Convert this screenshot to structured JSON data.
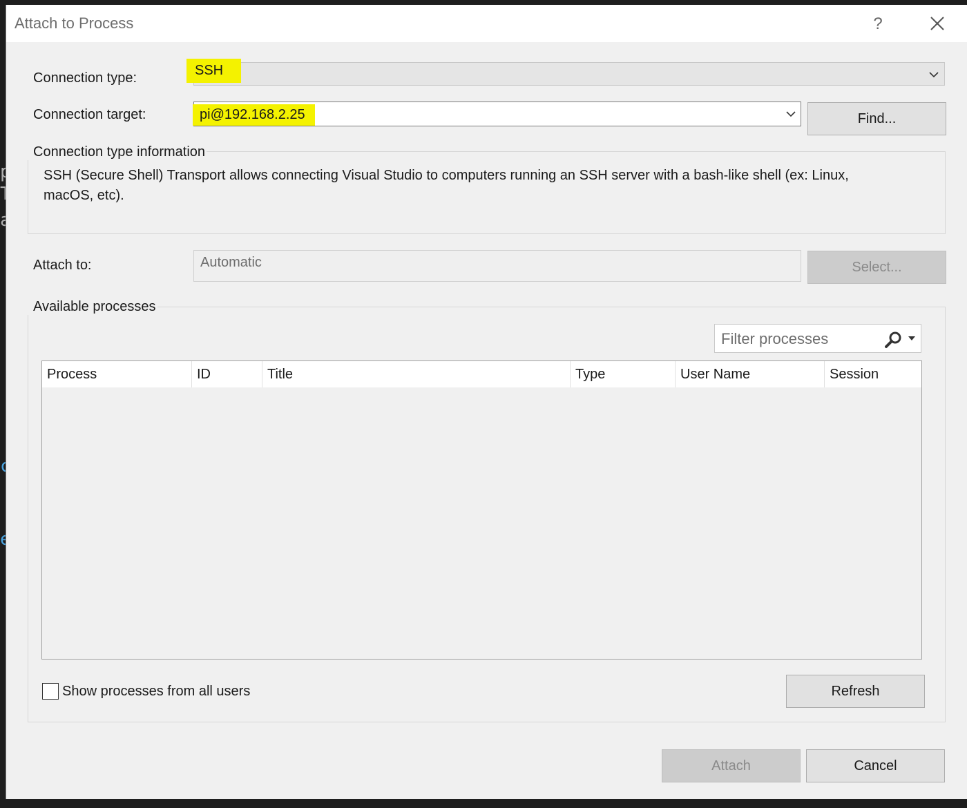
{
  "background": {
    "left_glyphs": [
      "p",
      "T",
      "a",
      "c",
      "e"
    ]
  },
  "dialog": {
    "title": "Attach to Process",
    "help_glyph": "?",
    "connection_type": {
      "label": "Connection type:",
      "value": "SSH"
    },
    "connection_target": {
      "label": "Connection target:",
      "value": "pi@192.168.2.25",
      "find_button": "Find..."
    },
    "info_group": {
      "legend": "Connection type information",
      "text": "SSH (Secure Shell) Transport allows connecting Visual Studio to computers running an SSH server with a bash-like shell (ex: Linux, macOS, etc)."
    },
    "attach_to": {
      "label": "Attach to:",
      "value": "Automatic",
      "select_button": "Select..."
    },
    "processes_group": {
      "legend": "Available processes",
      "filter_placeholder": "Filter processes",
      "columns": [
        "Process",
        "ID",
        "Title",
        "Type",
        "User Name",
        "Session"
      ],
      "rows": [],
      "show_all_users_label": "Show processes from all users",
      "show_all_users_checked": false,
      "refresh_button": "Refresh"
    },
    "attach_button": "Attach",
    "cancel_button": "Cancel"
  },
  "colors": {
    "highlight": "#f4f200",
    "dialog_bg": "#f0f0f0",
    "disabled_button": "#cccccc"
  }
}
